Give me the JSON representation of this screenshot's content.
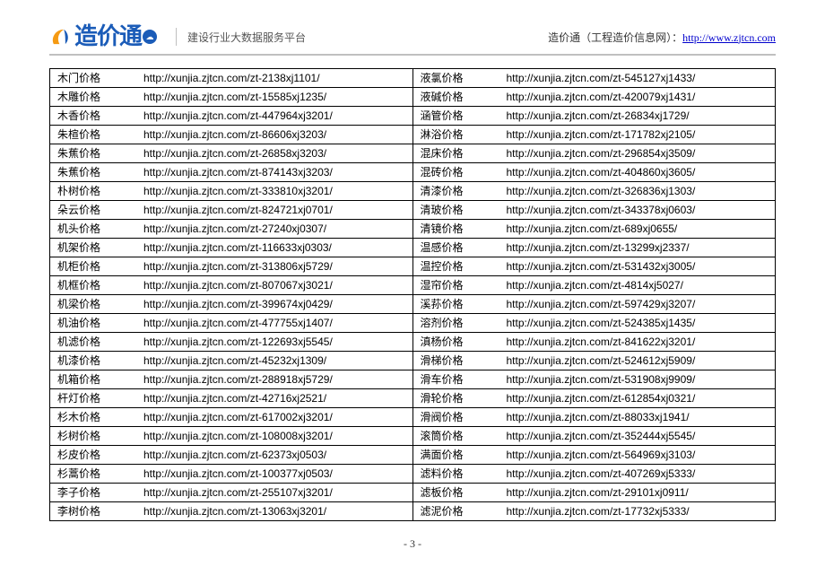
{
  "header": {
    "brand_name": "造价通",
    "tagline": "建设行业大数据服务平台",
    "right_label": "造价通（工程造价信息网）：",
    "right_link_text": "http://www.zjtcn.com"
  },
  "page_number": "- 3 -",
  "left_rows": [
    {
      "name": "木门价格",
      "url": "http://xunjia.zjtcn.com/zt-2138xj1101/"
    },
    {
      "name": "木雕价格",
      "url": "http://xunjia.zjtcn.com/zt-15585xj1235/"
    },
    {
      "name": "木香价格",
      "url": "http://xunjia.zjtcn.com/zt-447964xj3201/"
    },
    {
      "name": "朱楦价格",
      "url": "http://xunjia.zjtcn.com/zt-86606xj3203/"
    },
    {
      "name": "朱蕉价格",
      "url": "http://xunjia.zjtcn.com/zt-26858xj3203/"
    },
    {
      "name": "朱蕉价格",
      "url": "http://xunjia.zjtcn.com/zt-874143xj3203/"
    },
    {
      "name": "朴树价格",
      "url": "http://xunjia.zjtcn.com/zt-333810xj3201/"
    },
    {
      "name": "朵云价格",
      "url": "http://xunjia.zjtcn.com/zt-824721xj0701/"
    },
    {
      "name": "机头价格",
      "url": "http://xunjia.zjtcn.com/zt-27240xj0307/"
    },
    {
      "name": "机架价格",
      "url": "http://xunjia.zjtcn.com/zt-116633xj0303/"
    },
    {
      "name": "机柜价格",
      "url": "http://xunjia.zjtcn.com/zt-313806xj5729/"
    },
    {
      "name": "机框价格",
      "url": "http://xunjia.zjtcn.com/zt-807067xj3021/"
    },
    {
      "name": "机梁价格",
      "url": "http://xunjia.zjtcn.com/zt-399674xj0429/"
    },
    {
      "name": "机油价格",
      "url": "http://xunjia.zjtcn.com/zt-477755xj1407/"
    },
    {
      "name": "机滤价格",
      "url": "http://xunjia.zjtcn.com/zt-122693xj5545/"
    },
    {
      "name": "机漆价格",
      "url": "http://xunjia.zjtcn.com/zt-45232xj1309/"
    },
    {
      "name": "机箱价格",
      "url": "http://xunjia.zjtcn.com/zt-288918xj5729/"
    },
    {
      "name": "杆灯价格",
      "url": "http://xunjia.zjtcn.com/zt-42716xj2521/"
    },
    {
      "name": "杉木价格",
      "url": "http://xunjia.zjtcn.com/zt-617002xj3201/"
    },
    {
      "name": "杉树价格",
      "url": "http://xunjia.zjtcn.com/zt-108008xj3201/"
    },
    {
      "name": "杉皮价格",
      "url": "http://xunjia.zjtcn.com/zt-62373xj0503/"
    },
    {
      "name": "杉蒿价格",
      "url": "http://xunjia.zjtcn.com/zt-100377xj0503/"
    },
    {
      "name": "李子价格",
      "url": "http://xunjia.zjtcn.com/zt-255107xj3201/"
    },
    {
      "name": "李树价格",
      "url": "http://xunjia.zjtcn.com/zt-13063xj3201/"
    }
  ],
  "right_rows": [
    {
      "name": "液氯价格",
      "url": "http://xunjia.zjtcn.com/zt-545127xj1433/"
    },
    {
      "name": "液碱价格",
      "url": "http://xunjia.zjtcn.com/zt-420079xj1431/"
    },
    {
      "name": "涵管价格",
      "url": "http://xunjia.zjtcn.com/zt-26834xj1729/"
    },
    {
      "name": "淋浴价格",
      "url": "http://xunjia.zjtcn.com/zt-171782xj2105/"
    },
    {
      "name": "混床价格",
      "url": "http://xunjia.zjtcn.com/zt-296854xj3509/"
    },
    {
      "name": "混砖价格",
      "url": "http://xunjia.zjtcn.com/zt-404860xj3605/"
    },
    {
      "name": "清漆价格",
      "url": "http://xunjia.zjtcn.com/zt-326836xj1303/"
    },
    {
      "name": "清玻价格",
      "url": "http://xunjia.zjtcn.com/zt-343378xj0603/"
    },
    {
      "name": "清镜价格",
      "url": "http://xunjia.zjtcn.com/zt-689xj0655/"
    },
    {
      "name": "温感价格",
      "url": "http://xunjia.zjtcn.com/zt-13299xj2337/"
    },
    {
      "name": "温控价格",
      "url": "http://xunjia.zjtcn.com/zt-531432xj3005/"
    },
    {
      "name": "湿帘价格",
      "url": "http://xunjia.zjtcn.com/zt-4814xj5027/"
    },
    {
      "name": "溪荪价格",
      "url": "http://xunjia.zjtcn.com/zt-597429xj3207/"
    },
    {
      "name": "溶剂价格",
      "url": "http://xunjia.zjtcn.com/zt-524385xj1435/"
    },
    {
      "name": "滇杨价格",
      "url": "http://xunjia.zjtcn.com/zt-841622xj3201/"
    },
    {
      "name": "滑梯价格",
      "url": "http://xunjia.zjtcn.com/zt-524612xj5909/"
    },
    {
      "name": "滑车价格",
      "url": "http://xunjia.zjtcn.com/zt-531908xj9909/"
    },
    {
      "name": "滑轮价格",
      "url": "http://xunjia.zjtcn.com/zt-612854xj0321/"
    },
    {
      "name": "滑阀价格",
      "url": "http://xunjia.zjtcn.com/zt-88033xj1941/"
    },
    {
      "name": "滚筒价格",
      "url": "http://xunjia.zjtcn.com/zt-352444xj5545/"
    },
    {
      "name": "满面价格",
      "url": "http://xunjia.zjtcn.com/zt-564969xj3103/"
    },
    {
      "name": "滤料价格",
      "url": "http://xunjia.zjtcn.com/zt-407269xj5333/"
    },
    {
      "name": "滤板价格",
      "url": "http://xunjia.zjtcn.com/zt-29101xj0911/"
    },
    {
      "name": "滤泥价格",
      "url": "http://xunjia.zjtcn.com/zt-17732xj5333/"
    }
  ]
}
